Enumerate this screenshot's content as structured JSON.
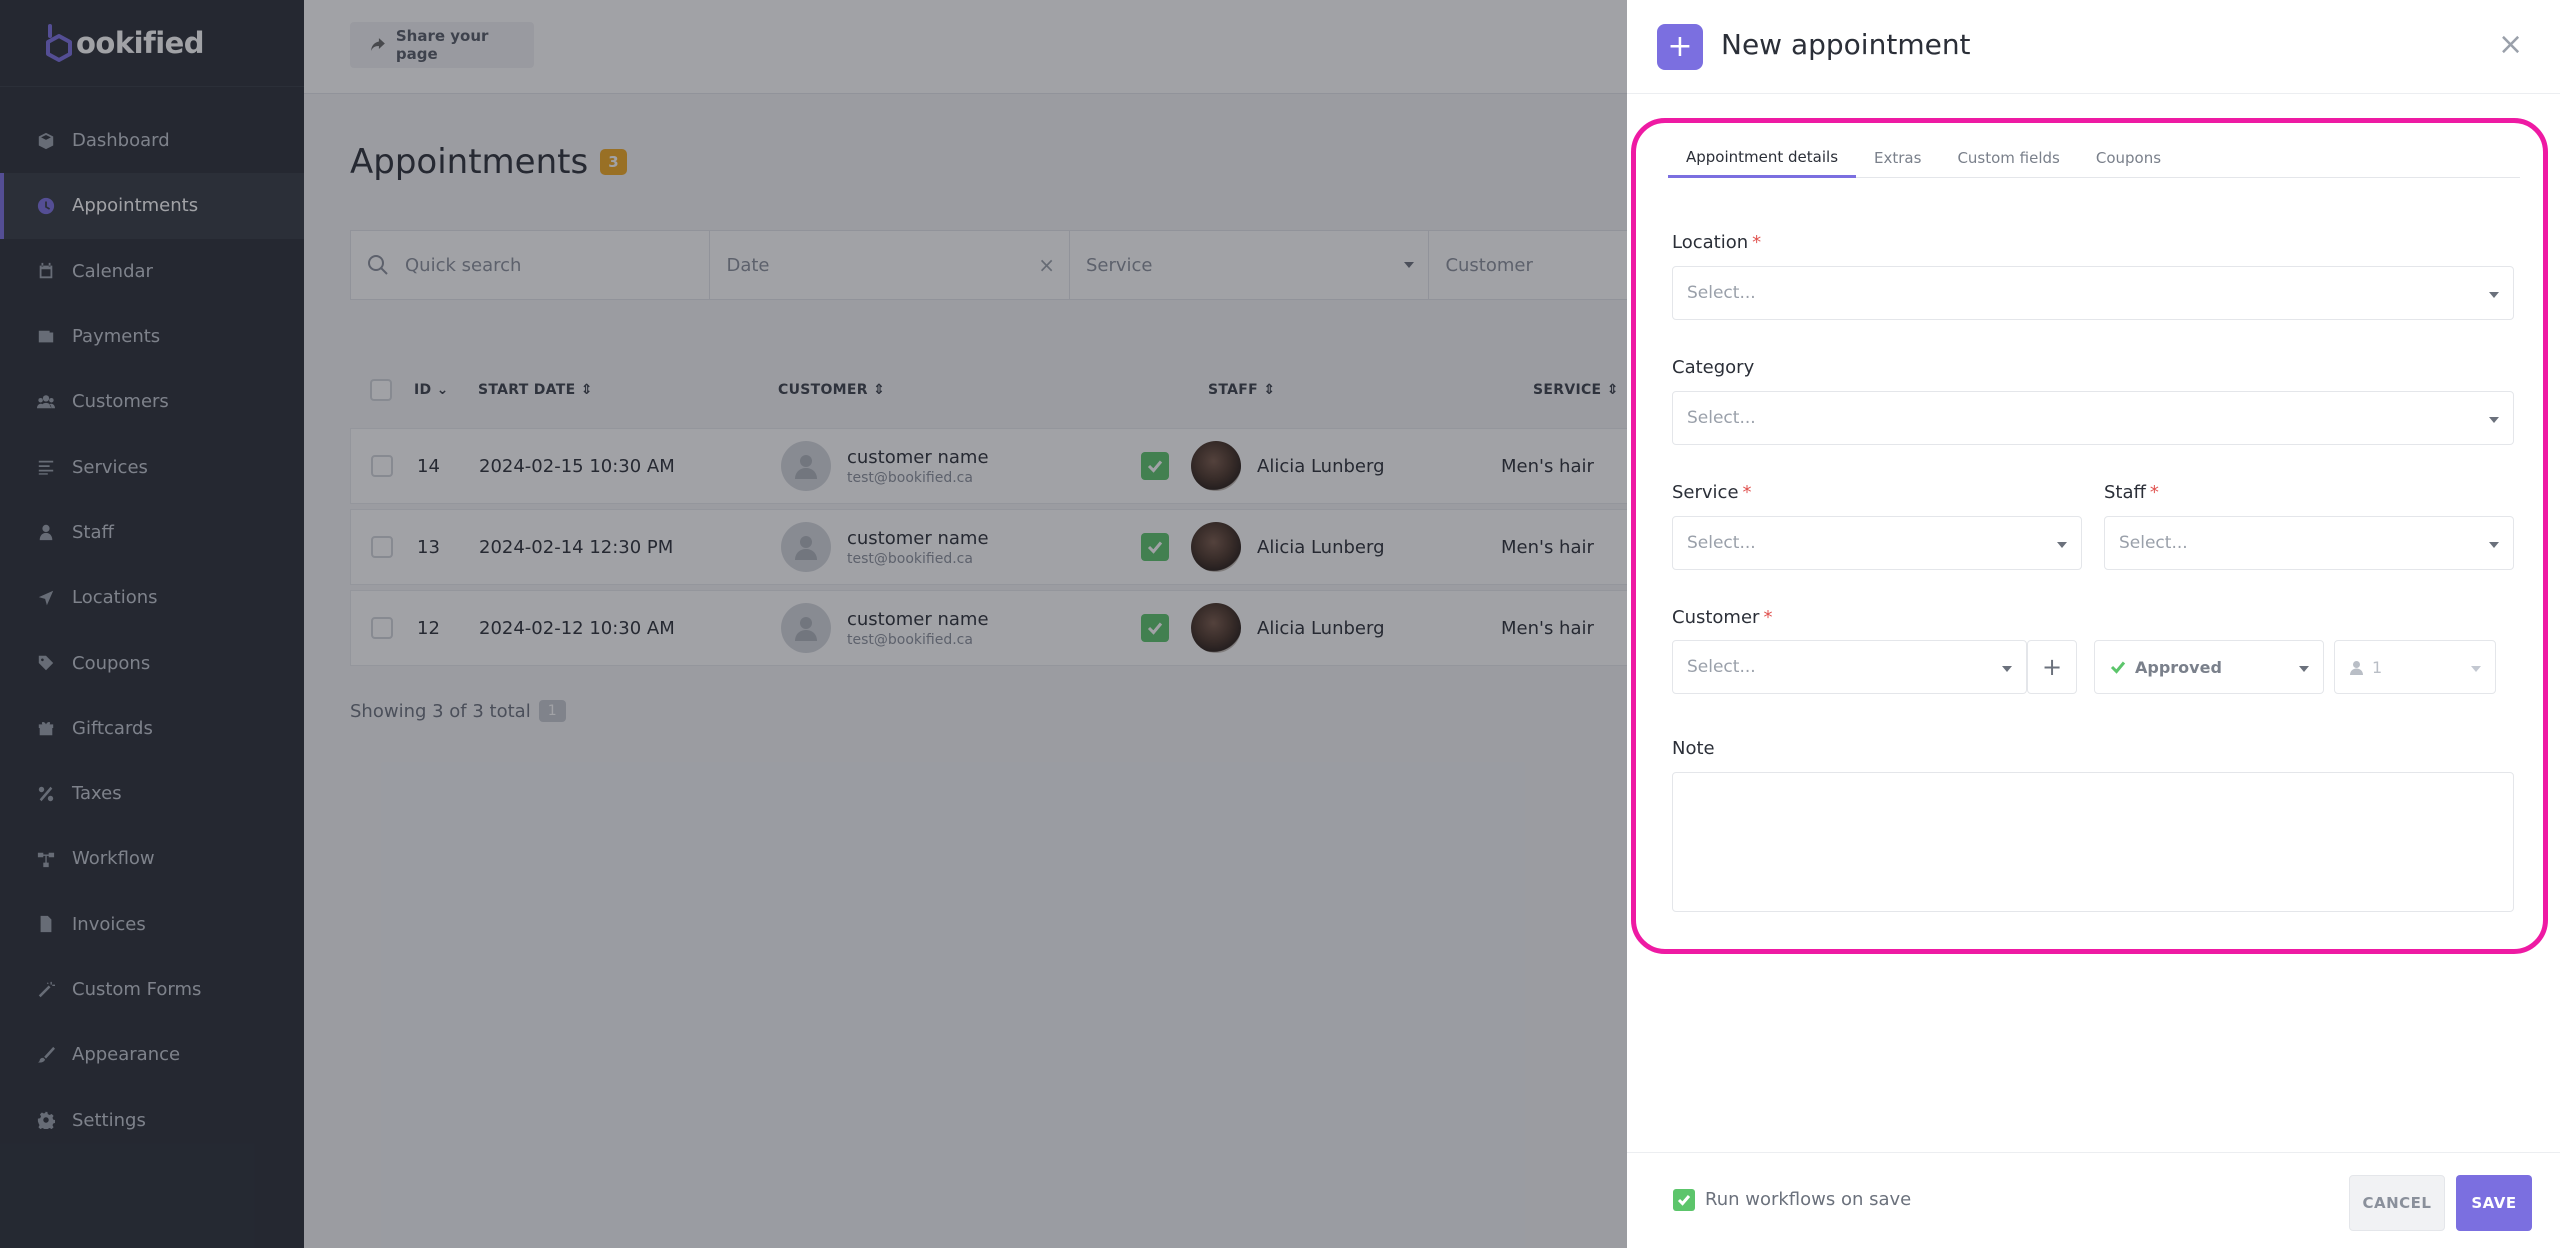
{
  "app": {
    "logo_text": "ookified",
    "brand_color": "#7b6fe0"
  },
  "sidebar": {
    "items": [
      {
        "label": "Dashboard",
        "icon": "cube-icon",
        "active": false
      },
      {
        "label": "Appointments",
        "icon": "clock-icon",
        "active": true
      },
      {
        "label": "Calendar",
        "icon": "calendar-icon",
        "active": false
      },
      {
        "label": "Payments",
        "icon": "wallet-icon",
        "active": false
      },
      {
        "label": "Customers",
        "icon": "users-icon",
        "active": false
      },
      {
        "label": "Services",
        "icon": "list-icon",
        "active": false
      },
      {
        "label": "Staff",
        "icon": "user-icon",
        "active": false
      },
      {
        "label": "Locations",
        "icon": "location-arrow-icon",
        "active": false
      },
      {
        "label": "Coupons",
        "icon": "tag-icon",
        "active": false
      },
      {
        "label": "Giftcards",
        "icon": "gift-icon",
        "active": false
      },
      {
        "label": "Taxes",
        "icon": "percent-icon",
        "active": false
      },
      {
        "label": "Workflow",
        "icon": "workflow-icon",
        "active": false
      },
      {
        "label": "Invoices",
        "icon": "file-icon",
        "active": false
      },
      {
        "label": "Custom Forms",
        "icon": "magic-wand-icon",
        "active": false
      },
      {
        "label": "Appearance",
        "icon": "brush-icon",
        "active": false
      },
      {
        "label": "Settings",
        "icon": "gear-icon",
        "active": false
      }
    ]
  },
  "topbar": {
    "share_label": "Share your page"
  },
  "appointments": {
    "title": "Appointments",
    "count": "3",
    "filters": {
      "search_placeholder": "Quick search",
      "date_placeholder": "Date",
      "service_placeholder": "Service",
      "customer_placeholder": "Customer"
    },
    "columns": {
      "id": "ID",
      "start_date": "START DATE",
      "customer": "CUSTOMER",
      "staff": "STAFF",
      "service": "SERVICE"
    },
    "rows": [
      {
        "id": "14",
        "start_date": "2024-02-15 10:30 AM",
        "customer_name": "customer name",
        "customer_email": "test@bookified.ca",
        "staff": "Alicia Lunberg",
        "service": "Men's hair"
      },
      {
        "id": "13",
        "start_date": "2024-02-14 12:30 PM",
        "customer_name": "customer name",
        "customer_email": "test@bookified.ca",
        "staff": "Alicia Lunberg",
        "service": "Men's hair"
      },
      {
        "id": "12",
        "start_date": "2024-02-12 10:30 AM",
        "customer_name": "customer name",
        "customer_email": "test@bookified.ca",
        "staff": "Alicia Lunberg",
        "service": "Men's hair"
      }
    ],
    "showing_text": "Showing 3 of 3 total",
    "page": "1"
  },
  "panel": {
    "title": "New appointment",
    "tabs": [
      "Appointment details",
      "Extras",
      "Custom fields",
      "Coupons"
    ],
    "active_tab": 0,
    "fields": {
      "location_label": "Location",
      "category_label": "Category",
      "service_label": "Service",
      "staff_label": "Staff",
      "customer_label": "Customer",
      "note_label": "Note",
      "select_placeholder": "Select...",
      "required_mark": "*",
      "status_value": "Approved",
      "people_count": "1"
    },
    "footer": {
      "run_workflows_label": "Run workflows on save",
      "run_workflows_checked": true,
      "cancel_label": "CANCEL",
      "save_label": "SAVE"
    },
    "highlight_color": "#ee1aa3"
  }
}
